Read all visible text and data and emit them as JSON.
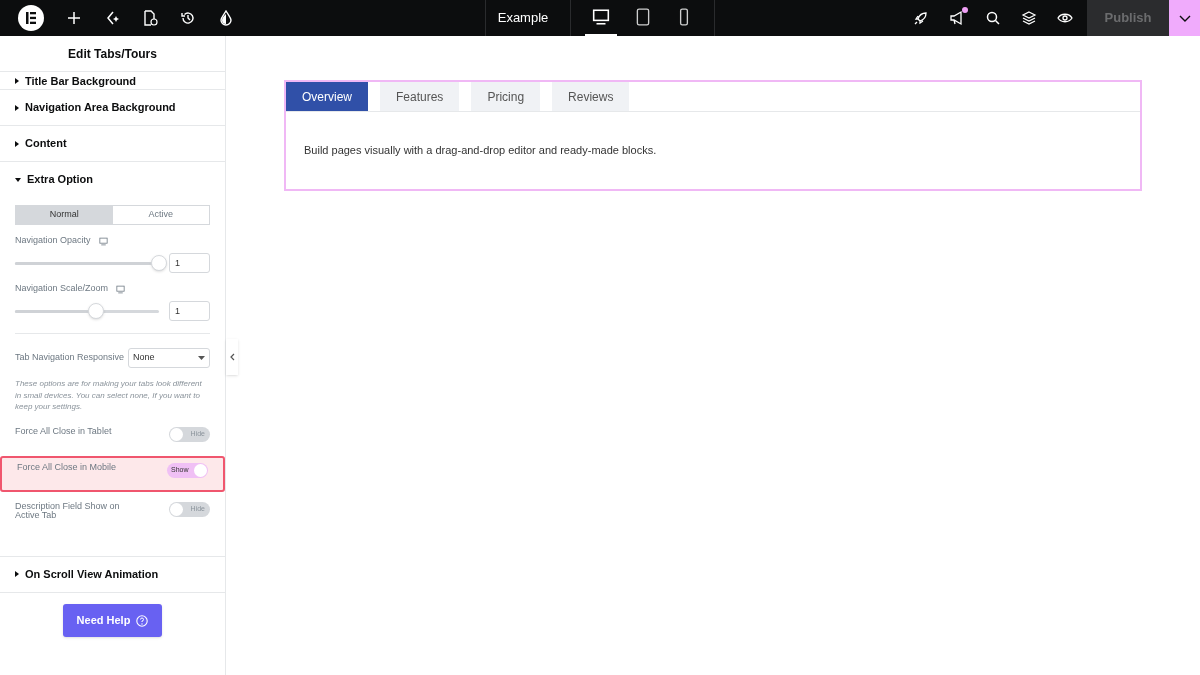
{
  "topbar": {
    "tools": [
      {
        "kind": "logo"
      },
      {
        "kind": "plus"
      },
      {
        "kind": "sparkle"
      },
      {
        "kind": "page"
      },
      {
        "kind": "history"
      },
      {
        "kind": "drop"
      }
    ],
    "page_title": "Example",
    "devices": [
      {
        "kind": "desktop",
        "selected": true
      },
      {
        "kind": "tablet",
        "selected": false
      },
      {
        "kind": "mobile",
        "selected": false
      }
    ],
    "actions": [
      {
        "kind": "rocket",
        "badge": false
      },
      {
        "kind": "megaphone",
        "badge": true
      },
      {
        "kind": "search",
        "badge": false
      },
      {
        "kind": "layers",
        "badge": false
      },
      {
        "kind": "eye",
        "badge": false
      }
    ],
    "publish": {
      "label": "Publish",
      "disabled": true
    }
  },
  "panel": {
    "title": "Edit Tabs/Tours",
    "sections": [
      {
        "label": "Title Bar Background",
        "expanded": false
      },
      {
        "label": "Navigation Area Background",
        "expanded": false
      },
      {
        "label": "Content",
        "expanded": false
      },
      {
        "label": "Extra Option",
        "expanded": true,
        "controls": [
          {
            "kind": "segments",
            "options": [
              {
                "label": "Normal",
                "selected": true
              },
              {
                "label": "Active",
                "selected": false
              }
            ]
          },
          {
            "kind": "slider",
            "label": "Navigation Opacity",
            "level": 1,
            "value": "1"
          },
          {
            "kind": "slider",
            "label": "Navigation Scale/Zoom",
            "level": 0.56,
            "value": "1"
          },
          {
            "kind": "divider"
          },
          {
            "kind": "select",
            "label": "Tab Navigation Responsive",
            "value": "None"
          },
          {
            "kind": "note",
            "text": "These options are for making your tabs look different in small devices. You can select none, If you want to keep your settings."
          },
          {
            "kind": "toggle",
            "label": "Force All Close in Tablet",
            "on": false,
            "state_label": "Hide",
            "highlighted": false
          },
          {
            "kind": "toggle",
            "label": "Force All Close in Mobile",
            "on": true,
            "state_label": "Show",
            "highlighted": true
          },
          {
            "kind": "toggle",
            "label": "Description Field Show on Active Tab",
            "on": false,
            "state_label": "Hide",
            "highlighted": false
          }
        ]
      },
      {
        "label": "On Scroll View Animation",
        "expanded": false
      }
    ],
    "help": {
      "label": "Need Help"
    }
  },
  "widget": {
    "tabs": [
      {
        "label": "Overview",
        "selected": true
      },
      {
        "label": "Features",
        "selected": false
      },
      {
        "label": "Pricing",
        "selected": false
      },
      {
        "label": "Reviews",
        "selected": false
      }
    ],
    "content": "Build pages visually with a drag-and-drop editor and ready-made blocks."
  }
}
